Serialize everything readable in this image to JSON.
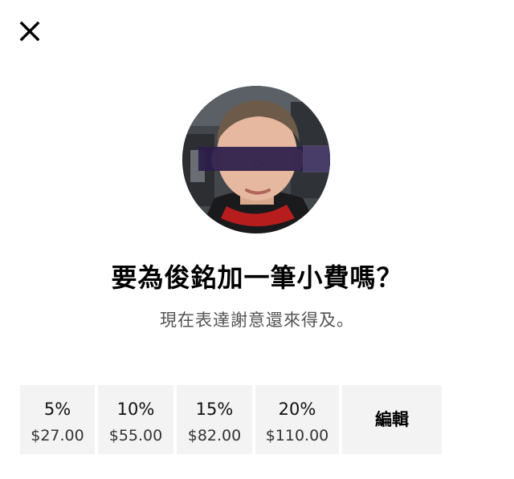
{
  "close": {
    "icon": "close-icon"
  },
  "driver": {
    "avatar_icon": "driver-avatar"
  },
  "title": "要為俊銘加一筆小費嗎？",
  "subtitle": "現在表達謝意還來得及。",
  "tips": [
    {
      "percent": "5%",
      "amount": "$27.00"
    },
    {
      "percent": "10%",
      "amount": "$55.00"
    },
    {
      "percent": "15%",
      "amount": "$82.00"
    },
    {
      "percent": "20%",
      "amount": "$110.00"
    }
  ],
  "edit_label": "編輯",
  "colors": {
    "tile_bg": "#f3f3f3",
    "subtitle": "#545454",
    "text": "#000000"
  }
}
